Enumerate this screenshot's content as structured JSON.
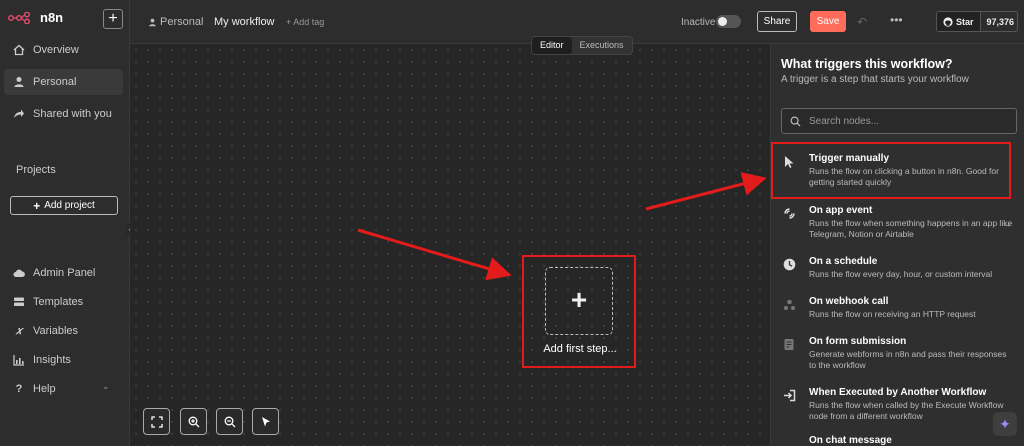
{
  "app": {
    "name": "n8n"
  },
  "sidebar": {
    "items": [
      {
        "label": "Overview",
        "icon": "home-icon"
      },
      {
        "label": "Personal",
        "icon": "user-icon"
      },
      {
        "label": "Shared with you",
        "icon": "share-icon"
      }
    ],
    "projects_label": "Projects",
    "add_project_label": "Add project",
    "bottom_items": [
      {
        "label": "Admin Panel",
        "icon": "cloud-icon"
      },
      {
        "label": "Templates",
        "icon": "templates-icon"
      },
      {
        "label": "Variables",
        "icon": "variables-icon"
      },
      {
        "label": "Insights",
        "icon": "insights-icon"
      },
      {
        "label": "Help",
        "icon": "help-icon"
      }
    ]
  },
  "header": {
    "breadcrumb_personal": "Personal",
    "workflow_title": "My workflow",
    "add_tag": "+ Add tag",
    "inactive_label": "Inactive",
    "share_label": "Share",
    "save_label": "Save",
    "github_star_label": "Star",
    "github_star_count": "97,376"
  },
  "canvas": {
    "tabs": [
      "Editor",
      "Executions"
    ],
    "active_tab": "Editor",
    "add_first_step_label": "Add first step..."
  },
  "panel": {
    "title": "What triggers this workflow?",
    "subtitle": "A trigger is a step that starts your workflow",
    "search_placeholder": "Search nodes...",
    "triggers": [
      {
        "name": "Trigger manually",
        "desc": "Runs the flow on clicking a button in n8n. Good for getting started quickly",
        "icon": "cursor-icon"
      },
      {
        "name": "On app event",
        "desc": "Runs the flow when something happens in an app like Telegram, Notion or Airtable",
        "icon": "app-event-icon"
      },
      {
        "name": "On a schedule",
        "desc": "Runs the flow every day, hour, or custom interval",
        "icon": "clock-icon"
      },
      {
        "name": "On webhook call",
        "desc": "Runs the flow on receiving an HTTP request",
        "icon": "webhook-icon"
      },
      {
        "name": "On form submission",
        "desc": "Generate webforms in n8n and pass their responses to the workflow",
        "icon": "form-icon"
      },
      {
        "name": "When Executed by Another Workflow",
        "desc": "Runs the flow when called by the Execute Workflow node from a different workflow",
        "icon": "sign-in-icon"
      },
      {
        "name": "On chat message",
        "desc": "",
        "icon": "chat-icon"
      }
    ]
  },
  "colors": {
    "accent": "#ff6d5a",
    "annotation": "#e21b1b",
    "panel_bg": "#2f2f2f"
  }
}
